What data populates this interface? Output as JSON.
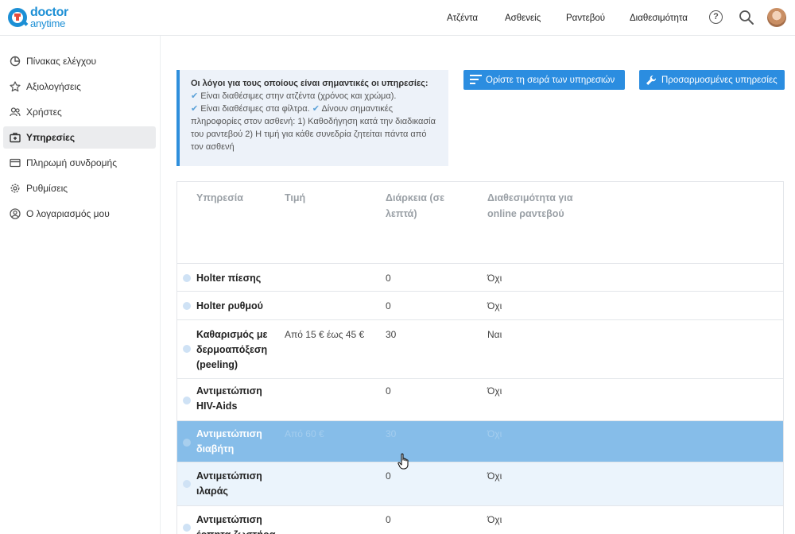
{
  "header": {
    "logo_word1": "doctor",
    "logo_word2": "anytime",
    "nav": [
      "Ατζέντα",
      "Ασθενείς",
      "Ραντεβού",
      "Διαθεσιμότητα"
    ],
    "help_glyph": "?",
    "icons": [
      "help-icon",
      "search-icon",
      "avatar"
    ]
  },
  "sidebar": {
    "items": [
      {
        "label": "Πίνακας ελέγχου",
        "icon": "pie-chart-icon"
      },
      {
        "label": "Αξιολογήσεις",
        "icon": "star-icon"
      },
      {
        "label": "Χρήστες",
        "icon": "users-icon"
      },
      {
        "label": "Υπηρεσίες",
        "icon": "medical-box-icon",
        "active": true
      },
      {
        "label": "Πληρωμή συνδρομής",
        "icon": "credit-card-icon"
      },
      {
        "label": "Ρυθμίσεις",
        "icon": "gear-icon"
      },
      {
        "label": "Ο λογαριασμός μου",
        "icon": "account-icon"
      }
    ]
  },
  "info": {
    "title": "Οι λόγοι για τους οποίους είναι σημαντικές οι υπηρεσίες:",
    "check_glyph": "✔",
    "reason1": "Είναι διαθέσιμες στην ατζέντα (χρόνος και χρώμα).",
    "reason2": "Είναι διαθέσιμες στα φίλτρα.",
    "reason3": "Δίνουν σημαντικές πληροφορίες στον ασθενή: 1) Καθοδήγηση κατά την διαδικασία του ραντεβού 2) Η τιμή για κάθε συνεδρία ζητείται πάντα από τον ασθενή"
  },
  "buttons": {
    "order_label": "Ορίστε τη σειρά των υπηρεσιών",
    "custom_label": "Προσαρμοσμένες υπηρεσίες"
  },
  "table": {
    "headers": {
      "service": "Υπηρεσία",
      "price": "Τιμή",
      "duration": "Διάρκεια (σε λεπτά)",
      "availability": "Διαθεσιμότητα για online ραντεβού"
    },
    "rows": [
      {
        "name": "Holter πίεσης",
        "price": "",
        "duration": "0",
        "availability": "Όχι"
      },
      {
        "name": "Holter ρυθμού",
        "price": "",
        "duration": "0",
        "availability": "Όχι"
      },
      {
        "name": "Καθαρισμός με δερμοαπόξεση (peeling)",
        "price": "Από 15 € έως 45 €",
        "duration": "30",
        "availability": "Ναι"
      },
      {
        "name": "Αντιμετώπιση HIV-Aids",
        "price": "",
        "duration": "0",
        "availability": "Όχι"
      },
      {
        "name": "Αντιμετώπιση διαβήτη",
        "price": "Από 60 €",
        "duration": "30",
        "availability": "Όχι",
        "state": "dragging"
      },
      {
        "name": "Αντιμετώπιση ιλαράς",
        "price": "",
        "duration": "0",
        "availability": "Όχι"
      },
      {
        "name": "Αντιμετώπιση έρπητα ζωστήρα",
        "price": "",
        "duration": "0",
        "availability": "Όχι"
      }
    ]
  },
  "colors": {
    "brand": "#1c8fd5",
    "button": "#2b8de0",
    "drag_row": "#86bde9",
    "info_bg": "#edf2f9"
  }
}
